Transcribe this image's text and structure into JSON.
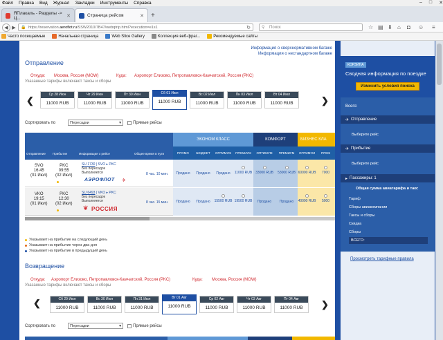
{
  "menu": [
    "Файл",
    "Правка",
    "Вид",
    "Журнал",
    "Закладки",
    "Инструменты",
    "Справка"
  ],
  "tabs": [
    {
      "title": "ЯПлакаль - Разделы -> Ц...",
      "active": false
    },
    {
      "title": "Страница рейсов",
      "active": true
    }
  ],
  "address": {
    "prefix": "https://reservation.",
    "domain": "aeroflot.ru",
    "path": "/SSW2010/7B47/webqtrip.html?execution=e1s1"
  },
  "search": {
    "placeholder": "Поиск"
  },
  "bookmarks": [
    "Часто посещаемые",
    "Начальная страница",
    "Web Slice Gallery",
    "Коллекция веб-фраг...",
    "Рекомендуемые сайты"
  ],
  "top_links": [
    "Информация о сверхнормативном багаже",
    "Информация о нестандартном багаже"
  ],
  "departure": {
    "title": "Отправление",
    "from_label": "Откуда:",
    "from": "Москва, Россия (MOW)",
    "to_label": "Куда:",
    "to": "Аэропорт Елизово, Петропавловск-Камчатский, Россия (PKC)",
    "note": "Указанные тарифы включают таксы и сборы",
    "dates": [
      {
        "day": "Ср 28 Июн",
        "price": "11000 RUB"
      },
      {
        "day": "Чт 29 Июн",
        "price": "11000 RUB"
      },
      {
        "day": "Пт 30 Июн",
        "price": "11000 RUB"
      },
      {
        "day": "Сб 01 Июл",
        "price": "11000 RUB",
        "selected": true
      },
      {
        "day": "Вс 02 Июл",
        "price": "11000 RUB"
      },
      {
        "day": "Пн 03 Июл",
        "price": "11000 RUB"
      },
      {
        "day": "Вт 04 Июл",
        "price": "11000 RUB"
      }
    ]
  },
  "sort": {
    "label": "Сортировать по",
    "value": "Пересадки",
    "direct": "Прямые рейсы"
  },
  "table": {
    "cols": [
      "Отправление",
      "Прибытие",
      "Информация о рейсе",
      "Общее время в пути"
    ],
    "classes": {
      "economy": "ЭКОНОМ КЛАСС",
      "comfort": "КОМФОРТ",
      "business": "БИЗНЕС КЛА"
    },
    "fares": [
      "ПРОМО",
      "БЮДЖЕТ",
      "ОПТИМУМ",
      "ПРЕМИУМ",
      "ОПТИМУМ",
      "ПРЕМИУМ",
      "ОПТИМУМ",
      "ПРЕМ"
    ],
    "rows": [
      {
        "dep_code": "SVO",
        "dep_time": "16:45",
        "dep_date": "(01 Июл)",
        "arr_code": "PKC",
        "arr_time": "09:55",
        "arr_date": "(02 Июл)",
        "flight": "SU 1730",
        "route_from": "SVO",
        "route_to": "PKC",
        "nonstop": "Без пересадок",
        "operated": "Выполняется",
        "airline": "АЭРОФЛОТ",
        "duration": "8 час. 10 мин.",
        "prices": [
          "Продано",
          "Продано",
          "Продано",
          "11000 RUB",
          "33000 RUB",
          "53000 RUB",
          "60000 RUB",
          "7000"
        ]
      },
      {
        "dep_code": "VKO",
        "dep_time": "19:15",
        "dep_date": "(01 Июл)",
        "arr_code": "PKC",
        "arr_time": "12:30",
        "arr_date": "(02 Июл)",
        "flight": "SU 6493",
        "route_from": "VKO",
        "route_to": "PKC",
        "nonstop": "Без пересадок",
        "operated": "Выполняется",
        "airline": "РОССИЯ",
        "duration": "8 час. 15 мин.",
        "prices": [
          "Продано",
          "Продано",
          "15500 RUB",
          "19500 RUB",
          "Продано",
          "Продано",
          "40000 RUB",
          "5000"
        ]
      }
    ]
  },
  "legend": [
    "Указывает на прибытие на следующий день",
    "Указывает на прибытие через два дня",
    "Указывает на прибытие в предыдущий день"
  ],
  "legend_colors": [
    "#f2b800",
    "#e36b1a",
    "#1e4fa3"
  ],
  "return": {
    "title": "Возвращение",
    "from_label": "Откуда:",
    "from": "Аэропорт Елизово, Петропавловск-Камчатский, Россия (PKC)",
    "to_label": "Куда:",
    "to": "Москва, Россия (MOW)",
    "note": "Указанные тарифы включают таксы и сборы",
    "dates": [
      {
        "day": "Сб 29 Июл",
        "price": "11000 RUB"
      },
      {
        "day": "Вс 30 Июл",
        "price": "11000 RUB"
      },
      {
        "day": "Пн 31 Июл",
        "price": "11000 RUB"
      },
      {
        "day": "Вт 01 Авг",
        "price": "11000 RUB",
        "selected": true
      },
      {
        "day": "Ср 02 Авг",
        "price": "11000 RUB"
      },
      {
        "day": "Чт 03 Авг",
        "price": "11000 RUB"
      },
      {
        "day": "Пт 04 Авг",
        "price": "11000 RUB"
      }
    ]
  },
  "sidebar": {
    "cart": "КОРЗИНА",
    "summary": "Сводная информация по поездке",
    "change_btn": "Изменить условия поиска",
    "total_label": "Всего:",
    "dep_head": "Отправление",
    "dep_choose": "Выберите рейс",
    "arr_head": "Прибытие",
    "arr_choose": "Выберите рейс",
    "pax": "Пассажиры: 1",
    "total_title": "Общая сумма авиатарифа и такс",
    "items": [
      "Тариф",
      "Сборы авиакомпании",
      "Таксы и сборы",
      "Скидка",
      "Сборы"
    ],
    "grand": "ВСЕГО:",
    "rules": "Просмотреть тарифные правила"
  }
}
